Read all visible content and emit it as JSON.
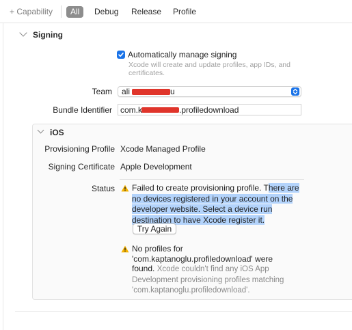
{
  "toolbar": {
    "capability_label": "+ Capability",
    "filters": [
      "All",
      "Debug",
      "Release",
      "Profile"
    ],
    "active_filter": "All"
  },
  "signing": {
    "section_title": "Signing",
    "auto_manage_label": "Automatically manage signing",
    "auto_manage_checked": true,
    "auto_manage_hint_line1": "Xcode will create and update profiles, app IDs, and",
    "auto_manage_hint_line2": "certificates.",
    "team_label": "Team",
    "team_value_prefix": "ali",
    "team_value_suffix": "u",
    "bundle_label": "Bundle Identifier",
    "bundle_value_prefix": "com.k",
    "bundle_value_suffix": ".profiledownload"
  },
  "ios": {
    "section_title": "iOS",
    "prov_profile_label": "Provisioning Profile",
    "prov_profile_value": "Xcode Managed Profile",
    "signing_cert_label": "Signing Certificate",
    "signing_cert_value": "Apple Development",
    "status_label": "Status",
    "error_part1": "Failed to create provisioning profile. T",
    "error_part2": "here are no devices registered in your account on the developer website. Select a device run destination to have Xcode register it.",
    "try_again_label": "Try Again",
    "no_profiles_line1": "No profiles for",
    "no_profiles_line2": "'com.kaptanoglu.profiledownload' were",
    "no_profiles_line3": "found.",
    "no_profiles_detail": "Xcode couldn't find any iOS App Development provisioning profiles matching 'com.kaptanoglu.profiledownload'."
  },
  "colors": {
    "accent": "#1a73e8",
    "selection": "#b3d3fb",
    "warning": "#f5b301",
    "redaction": "#e0352b"
  },
  "icons": {
    "checkbox": "checkmark-icon",
    "popup": "chevron-updown-icon",
    "warning": "warning-triangle-icon",
    "disclosure": "chevron-down-icon"
  }
}
